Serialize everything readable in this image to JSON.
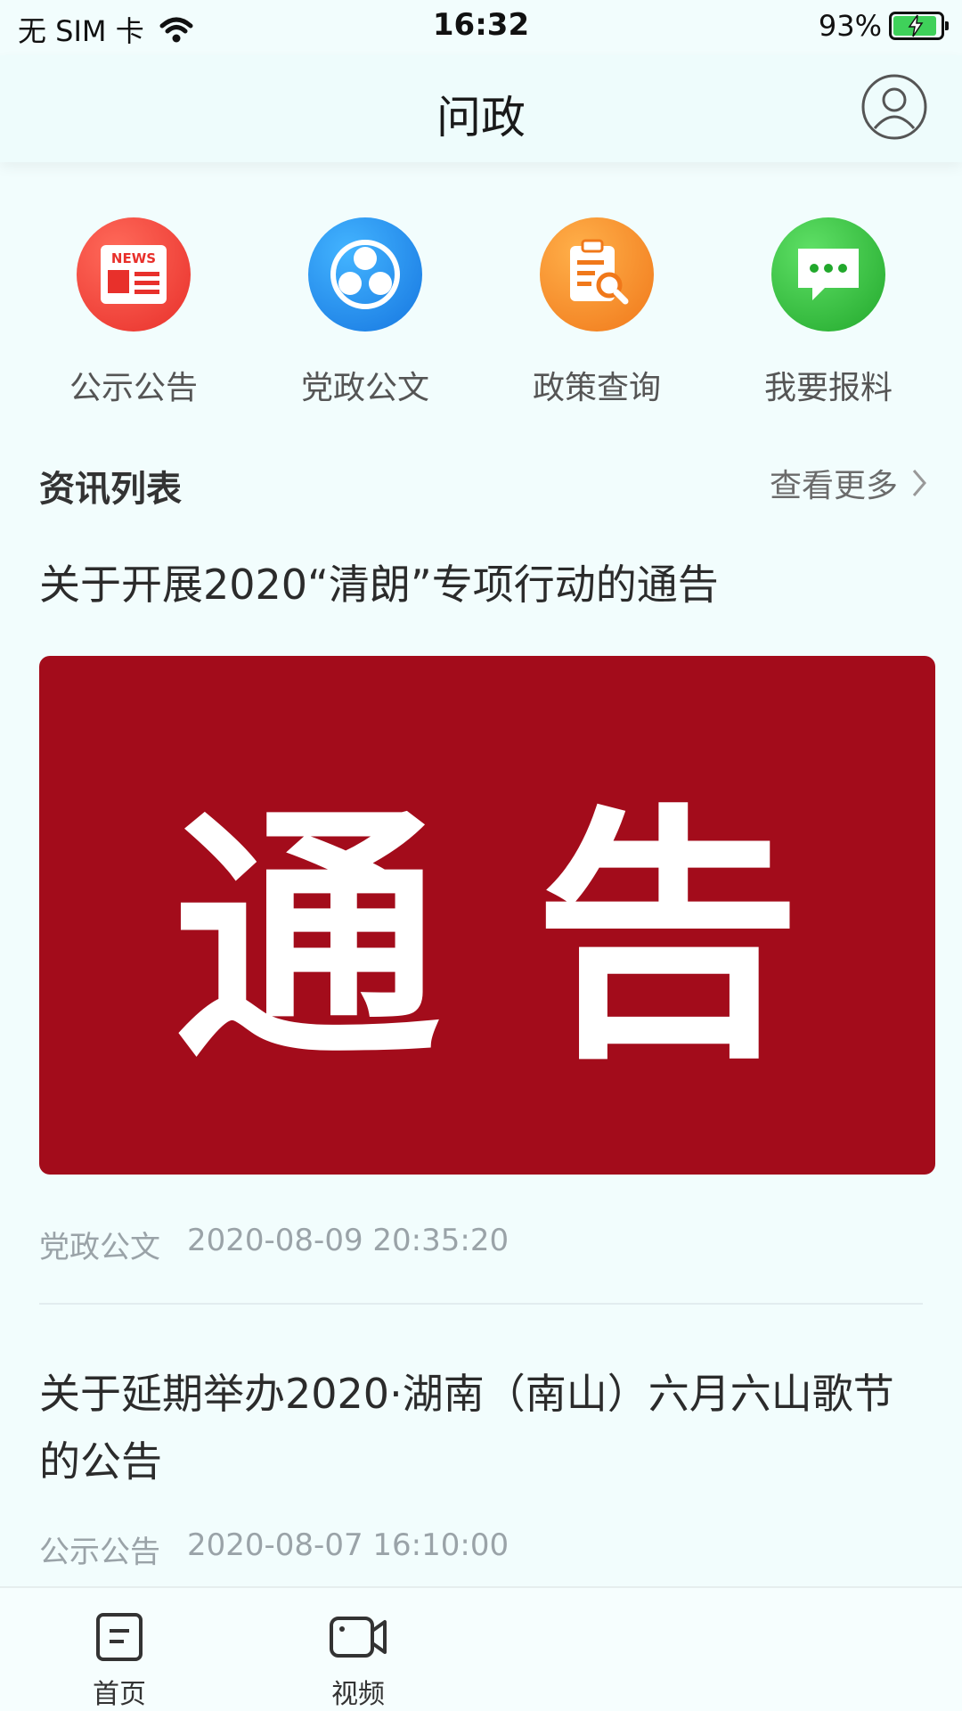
{
  "status_bar": {
    "carrier": "无 SIM 卡",
    "time": "16:32",
    "battery": "93%"
  },
  "header": {
    "title": "问政"
  },
  "quick_entries": [
    {
      "label": "公示公告",
      "icon": "news-icon",
      "color": "#f0433f"
    },
    {
      "label": "党政公文",
      "icon": "group-icon",
      "color": "#1f8ff0"
    },
    {
      "label": "政策查询",
      "icon": "clipboard-search-icon",
      "color": "#f79523"
    },
    {
      "label": "我要报料",
      "icon": "chat-bubble-icon",
      "color": "#36c33e"
    }
  ],
  "news_section": {
    "title": "资讯列表",
    "more_label": "查看更多"
  },
  "news": [
    {
      "title": "关于开展2020“清朗”专项行动的通告",
      "banner_text": "通 告",
      "category": "党政公文",
      "time": "2020-08-09 20:35:20"
    },
    {
      "title": "关于延期举办2020·湖南（南山）六月六山歌节的公告",
      "category": "公示公告",
      "time": "2020-08-07 16:10:00"
    }
  ],
  "tabbar": {
    "items": [
      {
        "label": "首页",
        "icon": "home-doc-icon"
      },
      {
        "label": "视频",
        "icon": "video-icon"
      }
    ]
  }
}
